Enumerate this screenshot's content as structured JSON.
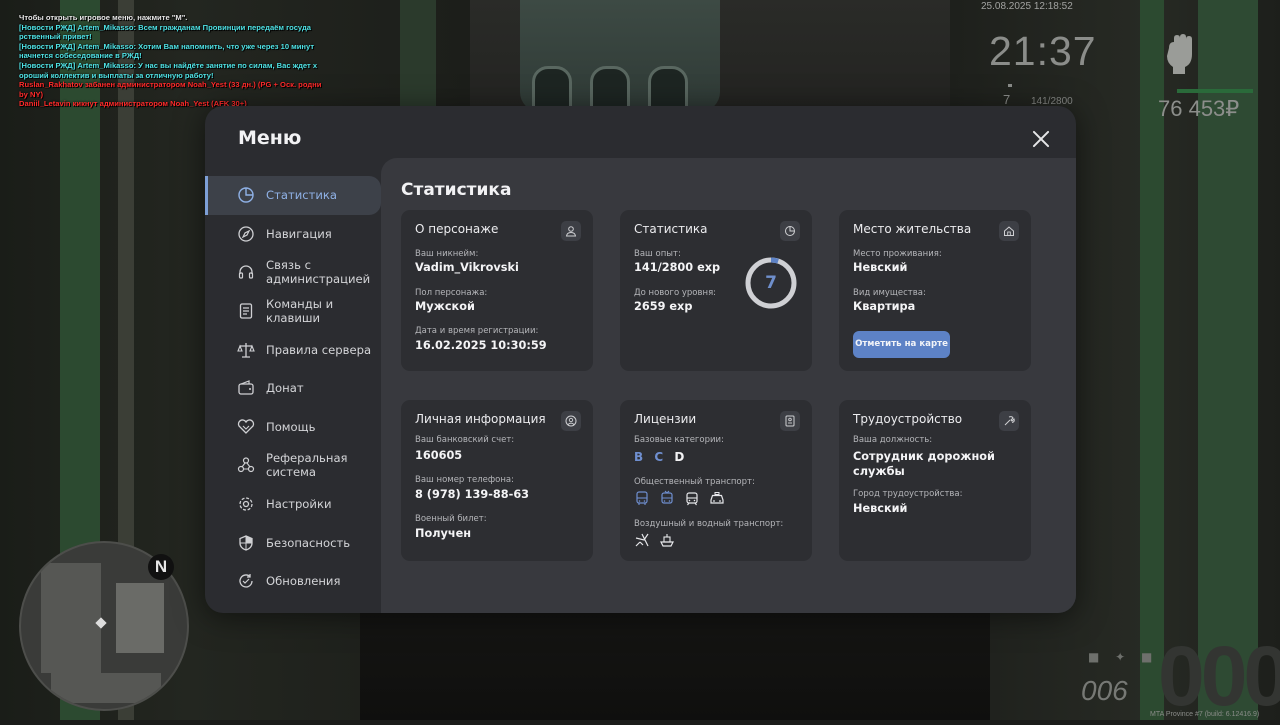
{
  "chat": [
    {
      "text": "Чтобы открыть игровое меню, нажмите \"M\".",
      "color": "white"
    },
    {
      "text": "[Новости РЖД] Artem_Mikasso: Всем гражданам Провинции передаём госуда",
      "color": "cyan"
    },
    {
      "text": "рственный привет!",
      "color": "cyan"
    },
    {
      "text": "[Новости РЖД] Artem_Mikasso: Хотим Вам напомнить, что уже через 10 минут",
      "color": "cyan"
    },
    {
      "text": "начнется собеседование в РЖД!",
      "color": "cyan"
    },
    {
      "text": "[Новости РЖД] Artem_Mikasso: У нас вы найдёте занятие по силам, Вас ждет х",
      "color": "cyan"
    },
    {
      "text": "ороший коллектив и выплаты за отличную работу!",
      "color": "cyan"
    },
    {
      "text": "Ruslan_Rakhatov забанен администратором Noah_Yest (33 дн.) (PG + Оск. родни",
      "color": "red"
    },
    {
      "text": " by NY)",
      "color": "red"
    },
    {
      "text": "Daniil_Letavin кикнут администратором Noah_Yest (AFK 30+)",
      "color": "red"
    }
  ],
  "hud": {
    "datetime": "25.08.2025 12:18:52",
    "time": "21:37",
    "level": "7",
    "exp": "141/2800",
    "money": "76 453₽",
    "speed": "000",
    "fuel": "006",
    "build": "MTA Province #7 (build: 6.12416.9)"
  },
  "minimap": {
    "north": "N"
  },
  "menu": {
    "title": "Меню",
    "sidebar": [
      {
        "label": "Статистика",
        "icon": "pie-chart-icon",
        "active": true
      },
      {
        "label": "Навигация",
        "icon": "compass-icon"
      },
      {
        "label": "Связь с администрацией",
        "icon": "headset-icon"
      },
      {
        "label": "Команды и клавиши",
        "icon": "document-icon"
      },
      {
        "label": "Правила сервера",
        "icon": "scales-icon"
      },
      {
        "label": "Донат",
        "icon": "wallet-icon"
      },
      {
        "label": "Помощь",
        "icon": "handshake-icon"
      },
      {
        "label": "Реферальная система",
        "icon": "referral-icon"
      },
      {
        "label": "Настройки",
        "icon": "gear-icon"
      },
      {
        "label": "Безопасность",
        "icon": "shield-icon"
      },
      {
        "label": "Обновления",
        "icon": "refresh-icon"
      }
    ],
    "content_title": "Статистика",
    "cards": {
      "character": {
        "title": "О персонаже",
        "icon": "user-icon",
        "nick_label": "Ваш никнейм:",
        "nick": "Vadim_Vikrovski",
        "gender_label": "Пол персонажа:",
        "gender": "Мужской",
        "reg_label": "Дата и время регистрации:",
        "reg": "16.02.2025 10:30:59"
      },
      "stats": {
        "title": "Статистика",
        "icon": "pie-chart-icon",
        "exp_label": "Ваш опыт:",
        "exp": "141/2800 exp",
        "next_label": "До нового уровня:",
        "next": "2659 exp",
        "level": "7",
        "progress": 0.0504
      },
      "residence": {
        "title": "Место жительства",
        "icon": "home-icon",
        "place_label": "Место проживания:",
        "place": "Невский",
        "property_label": "Вид имущества:",
        "property": "Квартира",
        "button": "Отметить на карте"
      },
      "personal": {
        "title": "Личная информация",
        "icon": "user-circle-icon",
        "bank_label": "Ваш банковский счет:",
        "bank": "160605",
        "phone_label": "Ваш номер телефона:",
        "phone": "8 (978) 139-88-63",
        "military_label": "Военный билет:",
        "military": "Получен"
      },
      "licenses": {
        "title": "Лицензии",
        "icon": "id-card-icon",
        "base_label": "Базовые категории:",
        "categories": [
          {
            "name": "B",
            "owned": true
          },
          {
            "name": "C",
            "owned": true
          },
          {
            "name": "D",
            "owned": false
          }
        ],
        "public_label": "Общественный транспорт:",
        "air_label": "Воздушный и водный транспорт:",
        "owned_color": "#6f8fd0"
      },
      "job": {
        "title": "Трудоустройство",
        "icon": "tools-icon",
        "position_label": "Ваша должность:",
        "position": "Сотрудник дорожной службы",
        "city_label": "Город трудоустройства:",
        "city": "Невский"
      }
    }
  }
}
